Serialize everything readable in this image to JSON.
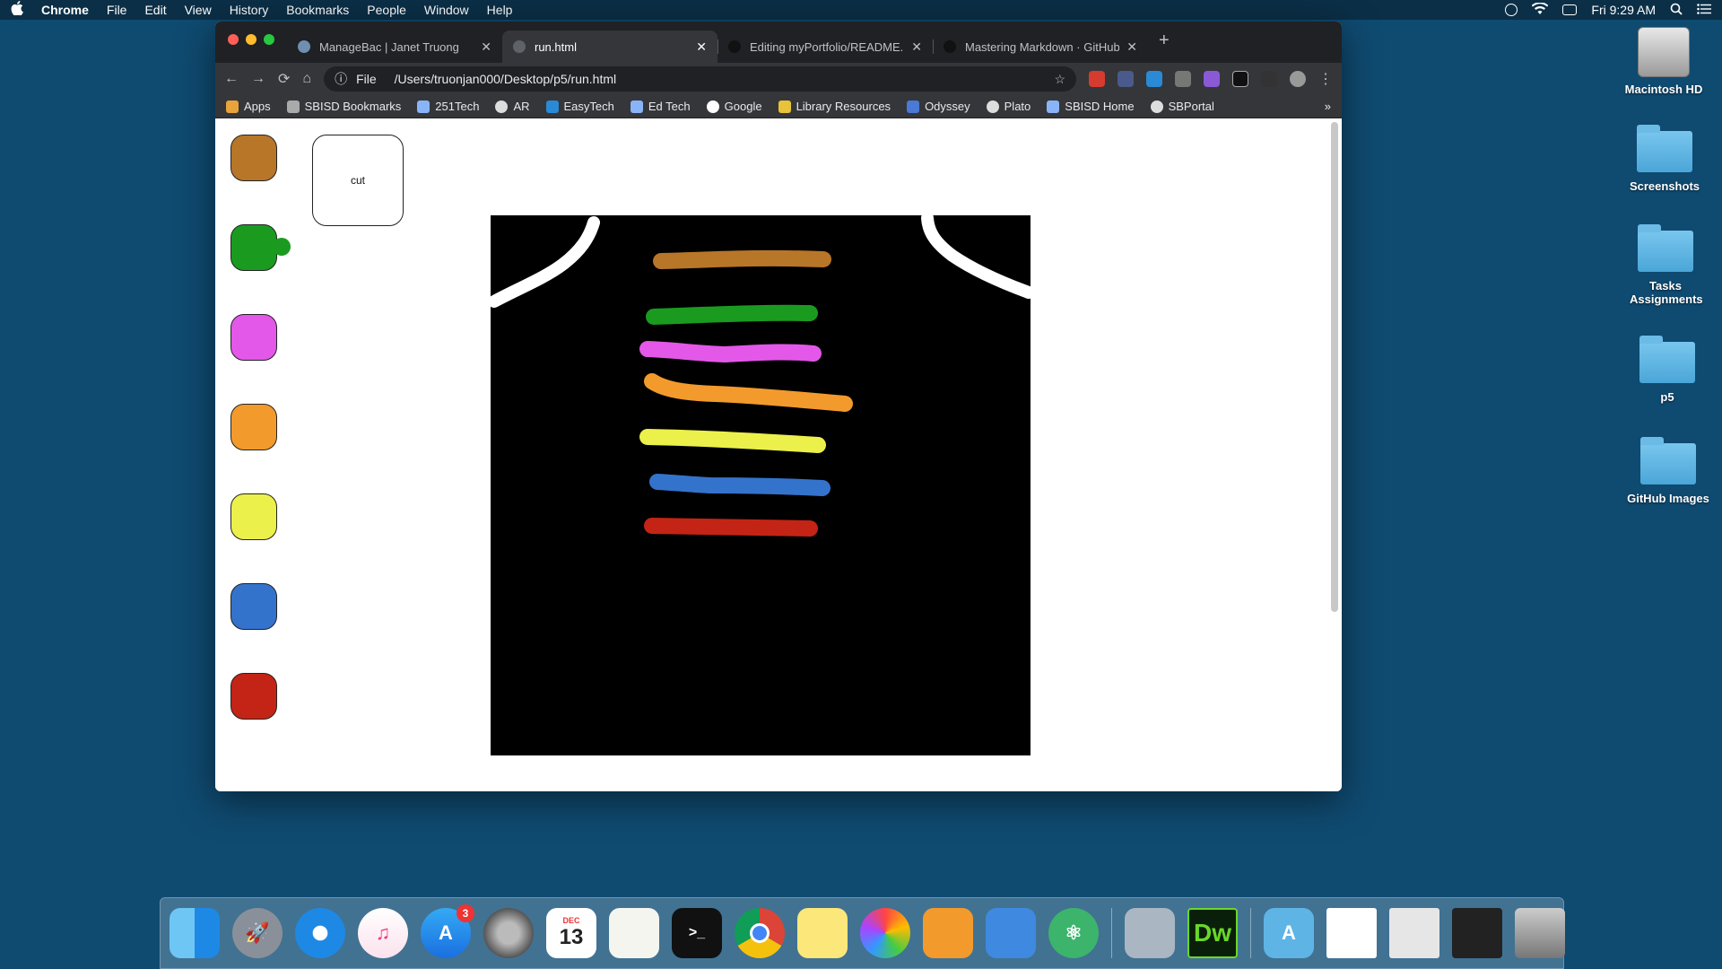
{
  "menubar": {
    "app": "Chrome",
    "items": [
      "File",
      "Edit",
      "View",
      "History",
      "Bookmarks",
      "People",
      "Window",
      "Help"
    ],
    "clock": "Fri 9:29 AM"
  },
  "desktop": {
    "icons": [
      {
        "label": "Macintosh HD"
      },
      {
        "label": "Screenshots"
      },
      {
        "label": "Tasks Assignments"
      },
      {
        "label": "p5"
      },
      {
        "label": "GitHub Images"
      }
    ]
  },
  "browser": {
    "tabs": [
      {
        "title": "ManageBac | Janet Truong"
      },
      {
        "title": "run.html"
      },
      {
        "title": "Editing myPortfolio/README.m"
      },
      {
        "title": "Mastering Markdown · GitHub"
      }
    ],
    "address": {
      "scheme_label": "File",
      "url": "/Users/truonjan000/Desktop/p5/run.html"
    },
    "bookmarks": [
      "Apps",
      "SBISD Bookmarks",
      "251Tech",
      "AR",
      "EasyTech",
      "Ed Tech",
      "Google",
      "Library Resources",
      "Odyssey",
      "Plato",
      "SBISD Home",
      "SBPortal"
    ],
    "bookmarks_more": "»"
  },
  "page": {
    "cut_label": "cut",
    "palette": [
      {
        "name": "brown",
        "color": "#b87628"
      },
      {
        "name": "green",
        "color": "#1a9b20"
      },
      {
        "name": "magenta",
        "color": "#e358e8"
      },
      {
        "name": "orange",
        "color": "#f39a2c"
      },
      {
        "name": "yellow",
        "color": "#ecf04a"
      },
      {
        "name": "blue",
        "color": "#3473cc"
      },
      {
        "name": "red",
        "color": "#c42415"
      }
    ],
    "canvas_background": "#000000"
  },
  "dock": {
    "calendar_month": "DEC",
    "calendar_day": "13",
    "app_store_badge": "3",
    "dw_label": "Dw"
  }
}
